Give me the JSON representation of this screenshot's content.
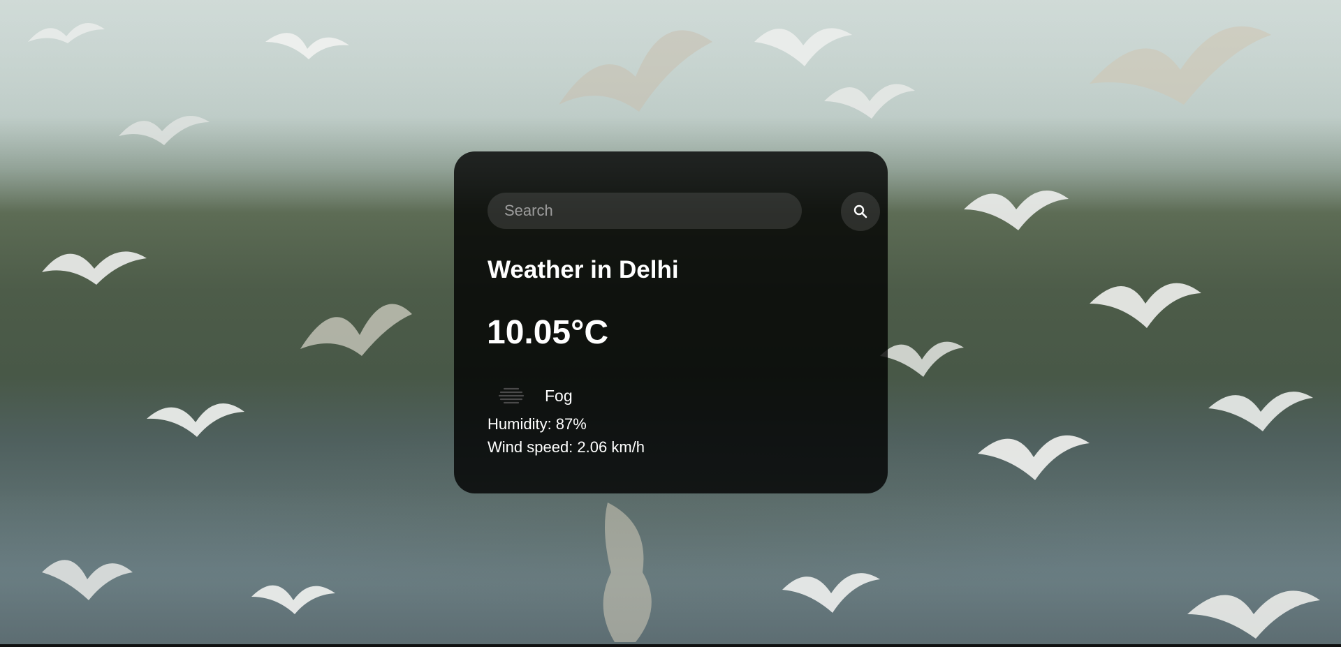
{
  "search": {
    "placeholder": "Search",
    "value": "",
    "button_icon": "search-icon"
  },
  "weather": {
    "title": "Weather in Delhi",
    "temperature": "10.05°C",
    "condition_icon": "fog-icon",
    "condition": "Fog",
    "humidity": "Humidity: 87%",
    "wind": "Wind speed: 2.06 km/h"
  },
  "colors": {
    "card_background": "#000000",
    "text": "#ffffff",
    "input_background": "#7c7c7c",
    "placeholder": "#9d9d9d",
    "backdrop_sky": "#c7d3cf",
    "backdrop_foliage": "#4d5c49",
    "backdrop_water": "#62757a"
  },
  "background": {
    "subject": "flock-of-gulls-over-water"
  }
}
